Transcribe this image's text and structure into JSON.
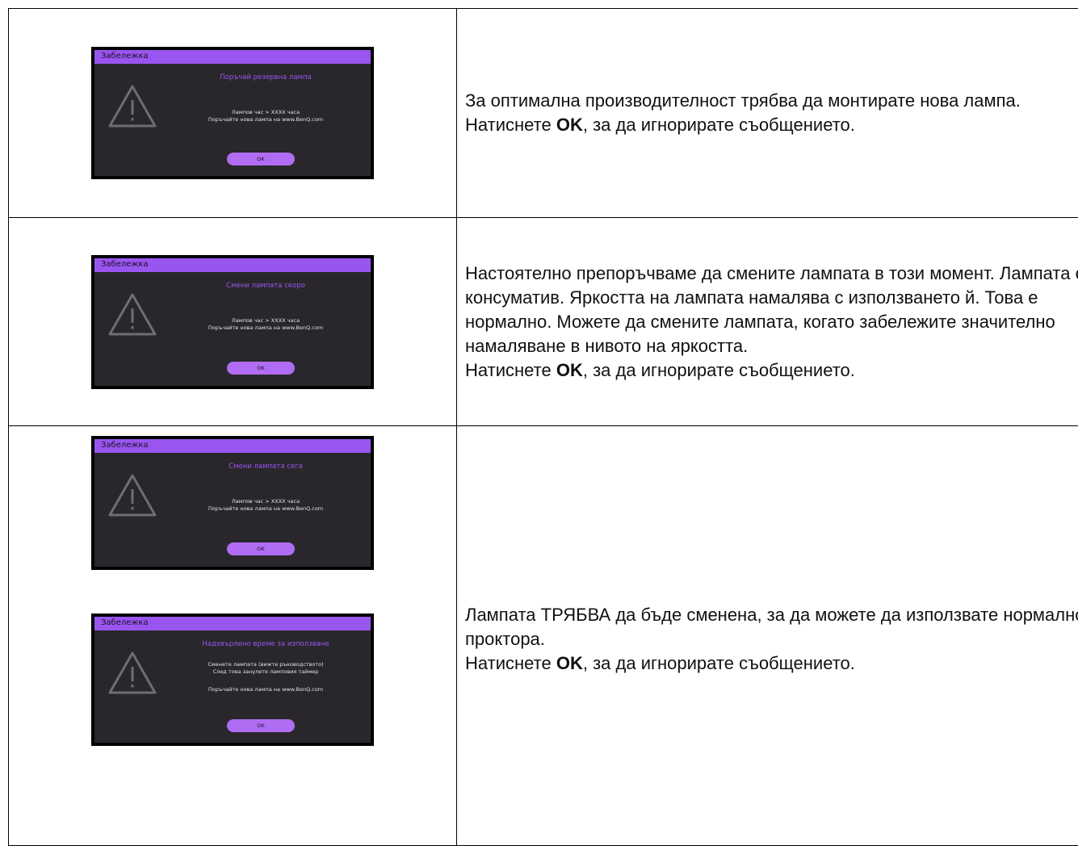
{
  "rows": [
    {
      "dialog": {
        "title": "Забележка",
        "heading": "Поръчай резервна лампа",
        "line1": "Лампов час > XXXX часа",
        "line2": "Поръчайте нова лампа на www.BenQ.com",
        "ok_label": "OK"
      },
      "text": {
        "part1": "За оптимална производителност трябва да монтирате нова лампа. Натиснете ",
        "ok": "OK",
        "part2": ", за да игнорирате съобщението."
      }
    },
    {
      "dialog": {
        "title": "Забележка",
        "heading": "Смени лампата скоро",
        "line1": "Лампов час > XXXX часа",
        "line2": "Поръчайте нова лампа на www.BenQ.com",
        "ok_label": "OK"
      },
      "text": {
        "part1": "Настоятелно препоръчваме да смените лампата в този момент. Лампата е консуматив. Яркостта на лампата намалява с използването й. Това е нормално. Можете да смените лампата, когато забележите значително намаляване в нивото на яркостта.",
        "part2_prefix": "Натиснете ",
        "ok": "OK",
        "part2": ", за да игнорирате съобщението."
      }
    },
    {
      "dialog_a": {
        "title": "Забележка",
        "heading": "Смени лампата сега",
        "line1": "Лампов час > XXXX часа",
        "line2": "Поръчайте нова лампа на www.BenQ.com",
        "ok_label": "OK"
      },
      "dialog_b": {
        "title": "Забележка",
        "heading": "Надхвърлено време за използване",
        "line1": "Сменете лампата (вижте ръководството)",
        "line2": "След това занулете ламповия таймер",
        "line3": "Поръчайте нова лампа на www.BenQ.com",
        "ok_label": "OK"
      },
      "text": {
        "part1": "Лампата ТРЯБВА да бъде сменена, за да можете да използвате нормално проктора.",
        "part2_prefix": "Натиснете ",
        "ok": "OK",
        "part2": ", за да игнорирате съобщението."
      }
    }
  ],
  "colors": {
    "accent": "#9a55f0",
    "osd_bg": "#29272b",
    "ok_button": "#b06cf2"
  }
}
